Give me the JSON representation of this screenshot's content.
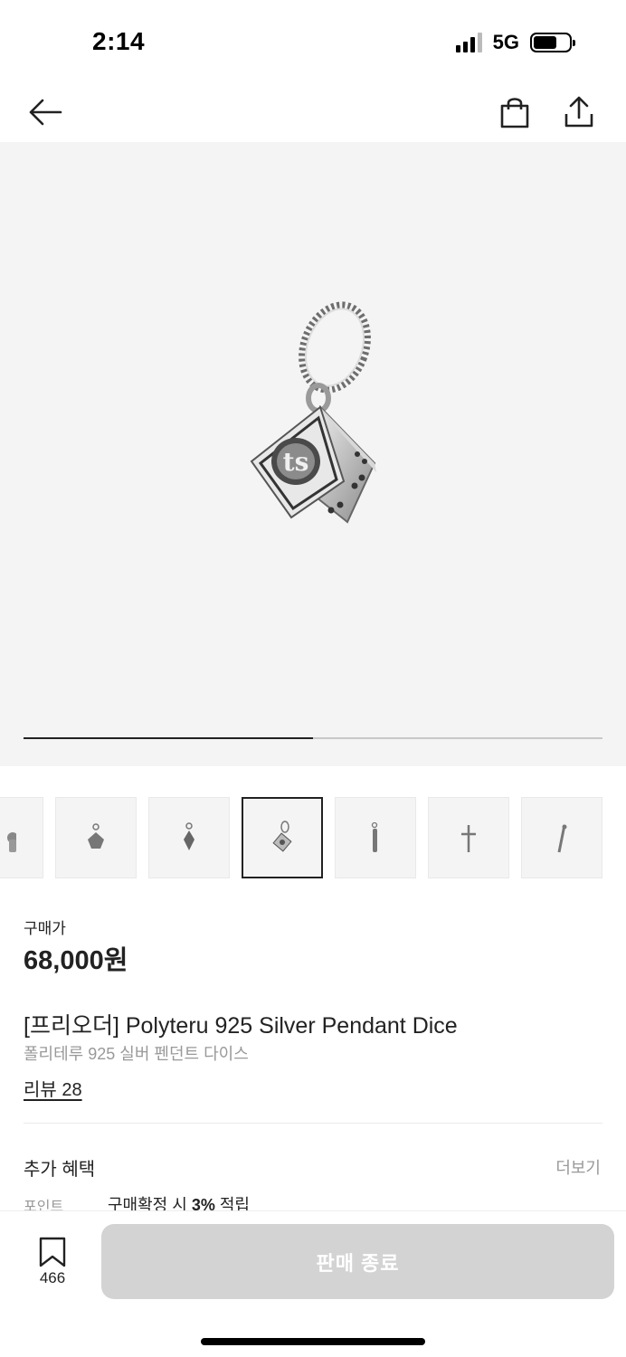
{
  "status_bar": {
    "time": "2:14",
    "network": "5G",
    "battery_level": 0.65
  },
  "nav": {
    "back_icon": "arrow-left-icon",
    "cart_icon": "shopping-bag-icon",
    "share_icon": "share-icon"
  },
  "gallery": {
    "progress": 0.5,
    "thumbnails": [
      {
        "icon": "pendant-thumb-icon",
        "active": false
      },
      {
        "icon": "pendant-thumb-icon",
        "active": false
      },
      {
        "icon": "pendant-thumb-icon",
        "active": false
      },
      {
        "icon": "pendant-dice-thumb-icon",
        "active": true
      },
      {
        "icon": "pendant-thumb-icon",
        "active": false
      },
      {
        "icon": "cross-pendant-thumb-icon",
        "active": false
      },
      {
        "icon": "pendant-thumb-icon",
        "active": false
      }
    ]
  },
  "product": {
    "price_label": "구매가",
    "price": "68,000원",
    "title": "[프리오더] Polyteru 925 Silver Pendant Dice",
    "subtitle": "폴리테루 925 실버 펜던트 다이스",
    "review_link": "리뷰 28"
  },
  "benefits": {
    "title": "추가 혜택",
    "more_label": "더보기",
    "point_label": "포인트",
    "point_text_prefix": "구매확정 시 ",
    "point_rate": "3%",
    "point_text_suffix": " 적립"
  },
  "bottom_bar": {
    "bookmark_count": "466",
    "action_label": "판매 종료"
  },
  "colors": {
    "accent": "#222222",
    "disabled": "#d3d3d3",
    "muted_text": "#999999",
    "image_bg": "#f4f4f4"
  }
}
